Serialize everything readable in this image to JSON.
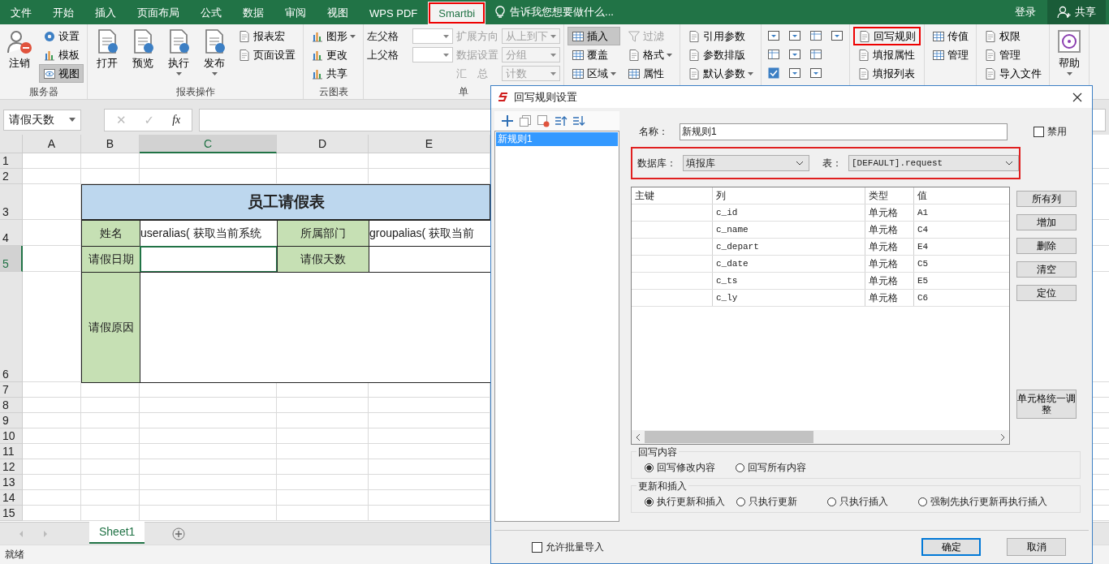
{
  "tabs": [
    {
      "label": "文件",
      "selected": false,
      "highlighted": false
    },
    {
      "label": "开始",
      "selected": false,
      "highlighted": false
    },
    {
      "label": "插入",
      "selected": false,
      "highlighted": false
    },
    {
      "label": "页面布局",
      "selected": false,
      "highlighted": false
    },
    {
      "label": "公式",
      "selected": false,
      "highlighted": false
    },
    {
      "label": "数据",
      "selected": false,
      "highlighted": false
    },
    {
      "label": "审阅",
      "selected": false,
      "highlighted": false
    },
    {
      "label": "视图",
      "selected": false,
      "highlighted": false
    },
    {
      "label": "WPS PDF",
      "selected": false,
      "highlighted": false
    },
    {
      "label": "Smartbi",
      "selected": true,
      "highlighted": true
    }
  ],
  "tell_me": {
    "placeholder": "告诉我您想要做什么..."
  },
  "account": {
    "login": "登录",
    "share": "共享"
  },
  "ribbon": [
    {
      "label": "服务器",
      "columns": [
        [
          {
            "kind": "large",
            "label": "注销",
            "menu": false
          }
        ],
        [
          {
            "kind": "small",
            "label": "设置",
            "pressed": false,
            "disabled": false,
            "menu": false,
            "highlighted": false
          },
          {
            "kind": "small",
            "label": "模板",
            "pressed": false,
            "disabled": false,
            "menu": false,
            "highlighted": false
          },
          {
            "kind": "small",
            "label": "视图",
            "pressed": true,
            "disabled": false,
            "menu": false,
            "highlighted": false
          }
        ]
      ]
    },
    {
      "label": "报表操作",
      "columns": [
        [
          {
            "kind": "large",
            "label": "打开",
            "menu": false
          }
        ],
        [
          {
            "kind": "large",
            "label": "预览",
            "menu": false
          }
        ],
        [
          {
            "kind": "large",
            "label": "执行",
            "menu": true
          }
        ],
        [
          {
            "kind": "large",
            "label": "发布",
            "menu": true
          }
        ],
        [
          {
            "kind": "small",
            "label": "报表宏",
            "pressed": false,
            "disabled": false,
            "menu": false,
            "highlighted": false
          },
          {
            "kind": "small",
            "label": "页面设置",
            "pressed": false,
            "disabled": false,
            "menu": false,
            "highlighted": false
          }
        ]
      ]
    },
    {
      "label": "云图表",
      "columns": [
        [
          {
            "kind": "small",
            "label": "图形",
            "pressed": false,
            "disabled": false,
            "menu": true,
            "highlighted": false
          },
          {
            "kind": "small",
            "label": "更改",
            "pressed": false,
            "disabled": false,
            "menu": false,
            "highlighted": false
          },
          {
            "kind": "small",
            "label": "共享",
            "pressed": false,
            "disabled": false,
            "menu": false,
            "highlighted": false
          }
        ]
      ]
    },
    {
      "label": "单",
      "columns": [
        [
          {
            "kind": "combo",
            "label": "左父格",
            "disabled": false
          },
          {
            "kind": "combo",
            "label": "上父格",
            "disabled": false
          }
        ],
        [
          {
            "kind": "combo",
            "label": "扩展方向",
            "value": "从上到下",
            "disabled": true
          },
          {
            "kind": "combo",
            "label": "数据设置",
            "value": "分组",
            "disabled": true
          },
          {
            "kind": "combo",
            "label": "汇　总",
            "value": "计数",
            "disabled": true
          }
        ]
      ]
    },
    {
      "columns": [
        [
          {
            "kind": "small",
            "label": "插入",
            "pressed": true,
            "disabled": false,
            "menu": false,
            "highlighted": false
          },
          {
            "kind": "small",
            "label": "覆盖",
            "pressed": false,
            "disabled": false,
            "menu": false,
            "highlighted": false
          },
          {
            "kind": "small",
            "label": "区域",
            "pressed": false,
            "disabled": false,
            "menu": true,
            "highlighted": false
          }
        ],
        [
          {
            "kind": "small",
            "label": "过滤",
            "pressed": false,
            "disabled": true,
            "menu": false,
            "highlighted": false
          },
          {
            "kind": "small",
            "label": "格式",
            "pressed": false,
            "disabled": false,
            "menu": true,
            "highlighted": false
          },
          {
            "kind": "small",
            "label": "属性",
            "pressed": false,
            "disabled": false,
            "menu": false,
            "highlighted": false
          }
        ]
      ]
    },
    {
      "columns": [
        [
          {
            "kind": "small",
            "label": "引用参数",
            "pressed": false,
            "disabled": false,
            "menu": false,
            "highlighted": false
          },
          {
            "kind": "small",
            "label": "参数排版",
            "pressed": false,
            "disabled": false,
            "menu": false,
            "highlighted": false
          },
          {
            "kind": "small",
            "label": "默认参数",
            "pressed": false,
            "disabled": false,
            "menu": true,
            "highlighted": false
          }
        ]
      ]
    },
    {
      "columns": [
        [
          {
            "kind": "icon"
          },
          {
            "kind": "icon"
          },
          {
            "kind": "icon"
          }
        ],
        [
          {
            "kind": "icon"
          },
          {
            "kind": "icon"
          },
          {
            "kind": "icon"
          }
        ],
        [
          {
            "kind": "icon"
          },
          {
            "kind": "icon"
          },
          {
            "kind": "icon"
          }
        ],
        [
          {
            "kind": "icon"
          }
        ]
      ]
    },
    {
      "columns": [
        [
          {
            "kind": "small",
            "label": "回写规则",
            "pressed": false,
            "disabled": false,
            "menu": false,
            "highlighted": true
          },
          {
            "kind": "small",
            "label": "填报属性",
            "pressed": false,
            "disabled": false,
            "menu": false,
            "highlighted": false
          },
          {
            "kind": "small",
            "label": "填报列表",
            "pressed": false,
            "disabled": false,
            "menu": false,
            "highlighted": false
          }
        ]
      ]
    },
    {
      "columns": [
        [
          {
            "kind": "small",
            "label": "传值",
            "pressed": false,
            "disabled": false,
            "menu": false,
            "highlighted": false
          },
          {
            "kind": "small",
            "label": "管理",
            "pressed": false,
            "disabled": false,
            "menu": false,
            "highlighted": false
          }
        ]
      ]
    },
    {
      "columns": [
        [
          {
            "kind": "small",
            "label": "权限",
            "pressed": false,
            "disabled": false,
            "menu": false,
            "highlighted": false
          },
          {
            "kind": "small",
            "label": "管理",
            "pressed": false,
            "disabled": false,
            "menu": false,
            "highlighted": false
          },
          {
            "kind": "small",
            "label": "导入文件",
            "pressed": false,
            "disabled": false,
            "menu": false,
            "highlighted": false
          }
        ]
      ]
    },
    {
      "columns": [
        [
          {
            "kind": "large",
            "label": "帮助",
            "menu": true
          }
        ]
      ]
    }
  ],
  "name_box": {
    "value": "请假天数"
  },
  "formula_bar": {
    "cancel": "✕",
    "enter": "✓",
    "function": "fx"
  },
  "sheet": {
    "columns": [
      {
        "label": "A",
        "selected": false
      },
      {
        "label": "B",
        "selected": false
      },
      {
        "label": "C",
        "selected": true
      },
      {
        "label": "D",
        "selected": false
      },
      {
        "label": "E",
        "selected": false
      }
    ],
    "rows": [
      {
        "label": "1",
        "selected": false
      },
      {
        "label": "2",
        "selected": false
      },
      {
        "label": "3",
        "selected": false
      },
      {
        "label": "4",
        "selected": false
      },
      {
        "label": "5",
        "selected": true
      },
      {
        "label": "6",
        "selected": false
      },
      {
        "label": "7",
        "selected": false
      },
      {
        "label": "8",
        "selected": false
      },
      {
        "label": "9",
        "selected": false
      },
      {
        "label": "10",
        "selected": false
      },
      {
        "label": "11",
        "selected": false
      },
      {
        "label": "12",
        "selected": false
      },
      {
        "label": "13",
        "selected": false
      },
      {
        "label": "14",
        "selected": false
      },
      {
        "label": "15",
        "selected": false
      }
    ],
    "title": "员工请假表",
    "form_rows": [
      [
        {
          "kind": "label",
          "text": "姓名",
          "selected": false
        },
        {
          "kind": "value",
          "text": "useralias( 获取当前系统",
          "selected": false
        },
        {
          "kind": "label",
          "text": "所属部门",
          "selected": false
        },
        {
          "kind": "value",
          "text": "groupalias( 获取当前",
          "selected": false
        }
      ],
      [
        {
          "kind": "label",
          "text": "请假日期",
          "selected": false
        },
        {
          "kind": "value",
          "selected": true
        },
        {
          "kind": "label",
          "text": "请假天数",
          "selected": false
        },
        {
          "kind": "value",
          "selected": false
        }
      ],
      [
        {
          "kind": "label",
          "text": "请假原因",
          "selected": false
        },
        {
          "kind": "value",
          "selected": false
        }
      ]
    ]
  },
  "sheet_tabs": [
    {
      "label": "Sheet1",
      "selected": true
    }
  ],
  "status": "就绪",
  "dialog": {
    "title": "回写规则设置",
    "rules": [
      {
        "label": "新规则1",
        "selected": true
      }
    ],
    "name_label": "名称：",
    "name_value": "新规则1",
    "disable_option": {
      "label": "禁用",
      "checked": false
    },
    "source_highlighted": true,
    "database_label": "数据库：",
    "database": "填报库",
    "table_label": "表：",
    "table": "[DEFAULT].request",
    "columns": [
      "主键",
      "列",
      "类型",
      "值"
    ],
    "rows": [
      {
        "column": "c_id",
        "type": "单元格",
        "value": "A1"
      },
      {
        "column": "c_name",
        "type": "单元格",
        "value": "C4"
      },
      {
        "column": "c_depart",
        "type": "单元格",
        "value": "E4"
      },
      {
        "column": "c_date",
        "type": "单元格",
        "value": "C5"
      },
      {
        "column": "c_ts",
        "type": "单元格",
        "value": "E5"
      },
      {
        "column": "c_ly",
        "type": "单元格",
        "value": "C6"
      }
    ],
    "side_buttons": [
      "所有列",
      "增加",
      "删除",
      "清空",
      "定位"
    ],
    "adjust_button": "单元格统一调整",
    "option_groups": [
      {
        "title": "回写内容",
        "options": [
          {
            "label": "回写修改内容",
            "selected": true
          },
          {
            "label": "回写所有内容",
            "selected": false
          }
        ]
      },
      {
        "title": "更新和插入",
        "options": [
          {
            "label": "执行更新和插入",
            "selected": true
          },
          {
            "label": "只执行更新",
            "selected": false
          },
          {
            "label": "只执行插入",
            "selected": false
          },
          {
            "label": "强制先执行更新再执行插入",
            "selected": false
          }
        ]
      }
    ],
    "batch_import": {
      "label": "允许批量导入",
      "checked": false
    },
    "ok": "确定",
    "cancel": "取消"
  }
}
